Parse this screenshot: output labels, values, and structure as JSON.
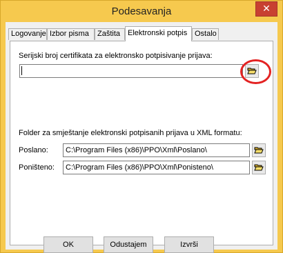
{
  "window": {
    "title": "Podesavanja",
    "close_glyph": "✕"
  },
  "tabs": [
    {
      "label": "Logovanje"
    },
    {
      "label": "Izbor pisma"
    },
    {
      "label": "Zaštita"
    },
    {
      "label": "Elektronski potpis",
      "active": true
    },
    {
      "label": "Ostalo"
    }
  ],
  "certificate": {
    "label": "Serijski broj certifikata za elektronsko potpisivanje prijava:",
    "value": "",
    "browse_icon": "folder-open-icon"
  },
  "folders": {
    "heading": "Folder za smještanje elektronski potpisanih prijava u XML formatu:",
    "sent_label": "Poslano:",
    "sent_value": "C:\\Program Files (x86)\\PPO\\Xml\\Poslano\\",
    "cancelled_label": "Poništeno:",
    "cancelled_value": "C:\\Program Files (x86)\\PPO\\Xml\\Ponisteno\\"
  },
  "buttons": {
    "ok": "OK",
    "cancel": "Odustajem",
    "execute": "Izvrši"
  },
  "colors": {
    "highlight": "#e32222",
    "title_bar": "#f6c94e",
    "close": "#c84031"
  }
}
